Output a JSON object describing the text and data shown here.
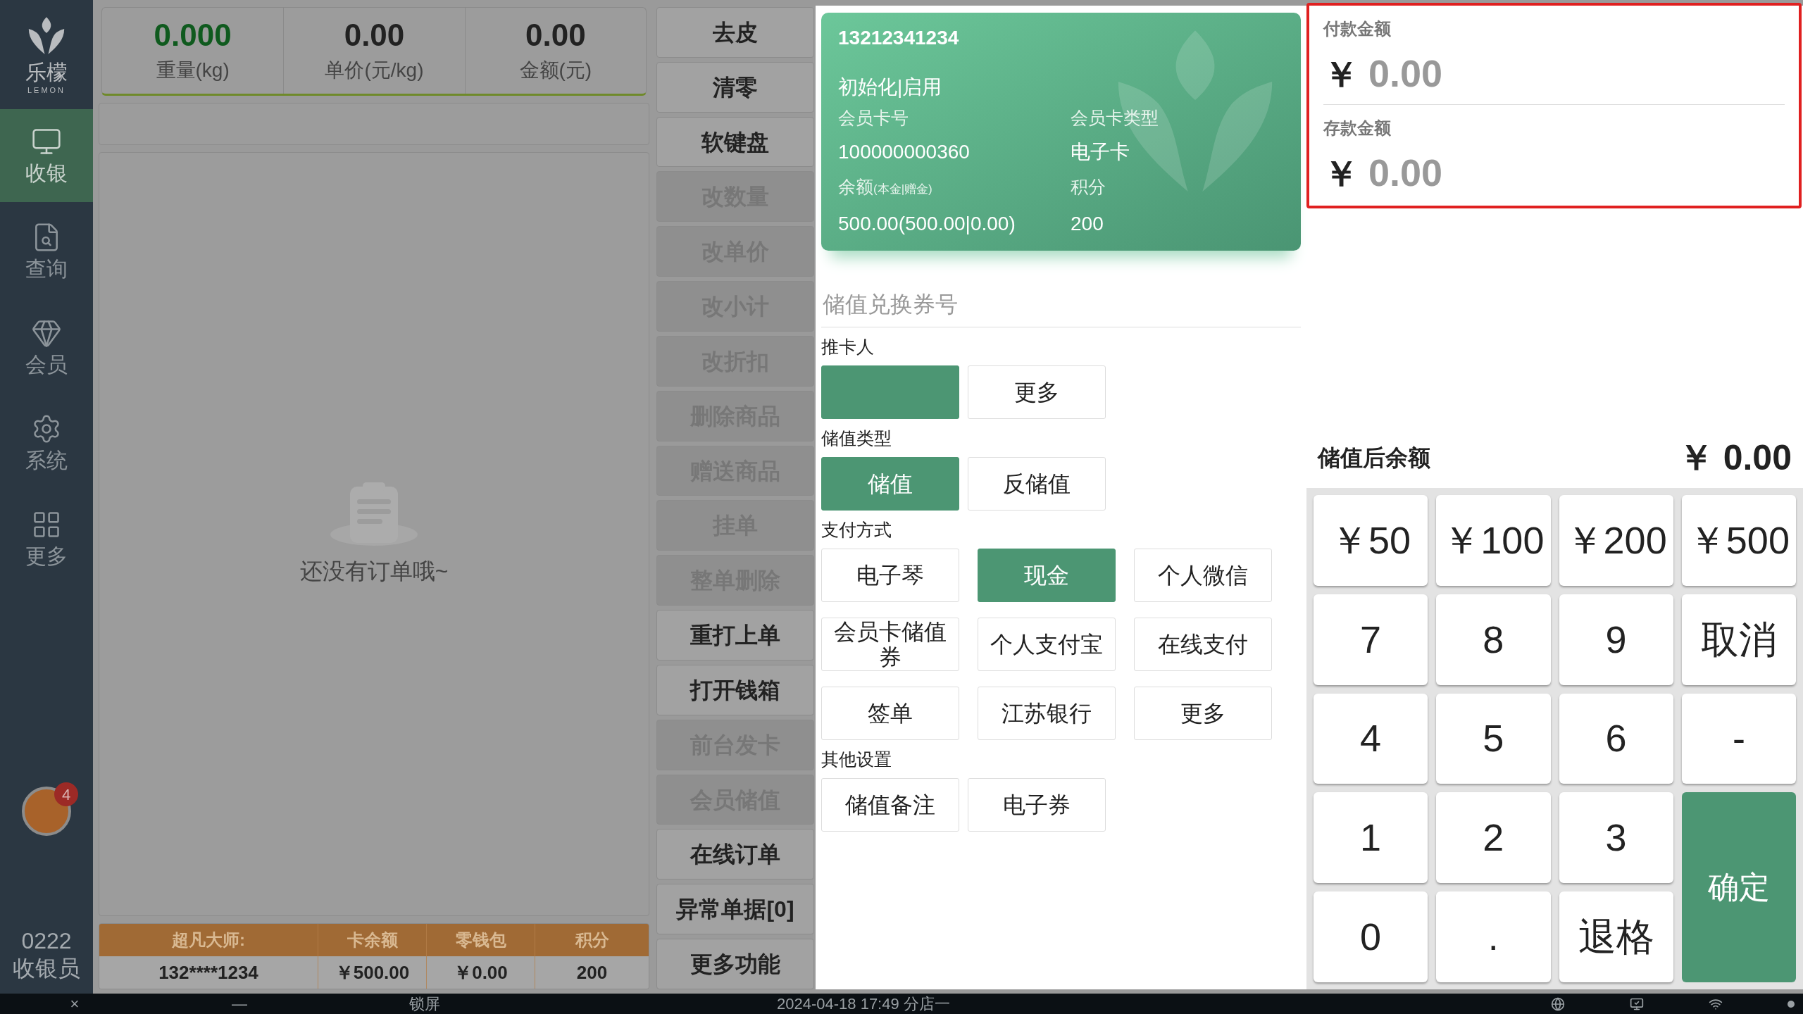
{
  "sidebar": {
    "logo_text": "乐檬",
    "logo_subtext": "LEMON",
    "items": [
      {
        "label": "收银",
        "selected": true,
        "kind": "cashier"
      },
      {
        "label": "查询",
        "selected": false,
        "kind": "query"
      },
      {
        "label": "会员",
        "selected": false,
        "kind": "member"
      },
      {
        "label": "系统",
        "selected": false,
        "kind": "system"
      },
      {
        "label": "更多",
        "selected": false,
        "kind": "more"
      }
    ],
    "notification_badge": "4",
    "user": {
      "id": "0222",
      "role": "收银员"
    }
  },
  "scale_readouts": [
    {
      "value": "0.000",
      "label": "重量(kg)",
      "highlighted": true
    },
    {
      "value": "0.00",
      "label": "单价(元/kg)",
      "highlighted": false
    },
    {
      "value": "0.00",
      "label": "金额(元)",
      "highlighted": false
    }
  ],
  "order_list": {
    "empty_message": "还没有订单哦~"
  },
  "member_table": {
    "columns": [
      "超凡大师:",
      "卡余额",
      "零钱包",
      "积分"
    ],
    "values": [
      "132****1234",
      "￥500.00",
      "￥0.00",
      "200"
    ]
  },
  "function_buttons": [
    {
      "label": "去皮",
      "disabled": false
    },
    {
      "label": "清零",
      "disabled": false
    },
    {
      "label": "软键盘",
      "disabled": false
    },
    {
      "label": "改数量",
      "disabled": true
    },
    {
      "label": "改单价",
      "disabled": true
    },
    {
      "label": "改小计",
      "disabled": true
    },
    {
      "label": "改折扣",
      "disabled": true
    },
    {
      "label": "删除商品",
      "disabled": true
    },
    {
      "label": "赠送商品",
      "disabled": true
    },
    {
      "label": "挂单",
      "disabled": true
    },
    {
      "label": "整单删除",
      "disabled": true
    },
    {
      "label": "重打上单",
      "disabled": false
    },
    {
      "label": "打开钱箱",
      "disabled": false
    },
    {
      "label": "前台发卡",
      "disabled": true
    },
    {
      "label": "会员储值",
      "disabled": true
    },
    {
      "label": "在线订单",
      "disabled": false
    },
    {
      "label": "异常单据[0]",
      "disabled": false
    },
    {
      "label": "更多功能",
      "disabled": false
    }
  ],
  "member_card": {
    "phone": "13212341234",
    "status": "初始化|启用",
    "fields": [
      {
        "label": "会员卡号",
        "value": "100000000360"
      },
      {
        "label": "会员卡类型",
        "value": "电子卡"
      },
      {
        "label": "余额",
        "note": "(本金|赠金)",
        "value": "500.00(500.00|0.00)"
      },
      {
        "label": "积分",
        "value": "200"
      }
    ]
  },
  "coupon_field": {
    "placeholder": "储值兑换券号"
  },
  "form_sections": [
    {
      "title": "推卡人",
      "options": [
        {
          "selected": true
        },
        {
          "label": "更多",
          "selected": false
        }
      ]
    },
    {
      "title": "储值类型",
      "options": [
        {
          "label": "储值",
          "selected": true
        },
        {
          "label": "反储值",
          "selected": false
        }
      ]
    },
    {
      "title": "支付方式",
      "options": [
        {
          "label": "电子琴",
          "selected": false
        },
        {
          "label": "现金",
          "selected": true
        },
        {
          "label": "个人微信",
          "selected": false
        },
        {
          "label": "会员卡储值券",
          "selected": false
        },
        {
          "label": "个人支付宝",
          "selected": false
        },
        {
          "label": "在线支付",
          "selected": false
        },
        {
          "label": "签单",
          "selected": false
        },
        {
          "label": "江苏银行",
          "selected": false
        },
        {
          "label": "更多",
          "selected": false
        }
      ]
    },
    {
      "title": "其他设置",
      "options": [
        {
          "label": "储值备注",
          "selected": false
        },
        {
          "label": "电子券",
          "selected": false
        }
      ]
    }
  ],
  "amounts": [
    {
      "label": "付款金额",
      "currency": "￥",
      "value": "0.00"
    },
    {
      "label": "存款金额",
      "currency": "￥",
      "value": "0.00"
    }
  ],
  "balance_after": {
    "label": "储值后余额",
    "value": "￥ 0.00"
  },
  "keypad": [
    {
      "label": "￥50",
      "kind": "key"
    },
    {
      "label": "￥100",
      "kind": "key"
    },
    {
      "label": "￥200",
      "kind": "key"
    },
    {
      "label": "￥500",
      "kind": "key"
    },
    {
      "label": "7",
      "kind": "key"
    },
    {
      "label": "8",
      "kind": "key"
    },
    {
      "label": "9",
      "kind": "key"
    },
    {
      "label": "取消",
      "kind": "key"
    },
    {
      "label": "4",
      "kind": "key"
    },
    {
      "label": "5",
      "kind": "key"
    },
    {
      "label": "6",
      "kind": "key"
    },
    {
      "label": "-",
      "kind": "key"
    },
    {
      "label": "1",
      "kind": "key"
    },
    {
      "label": "2",
      "kind": "key"
    },
    {
      "label": "3",
      "kind": "key"
    },
    {
      "label": "确定",
      "kind": "confirm"
    },
    {
      "label": "0",
      "kind": "key"
    },
    {
      "label": ".",
      "kind": "key"
    },
    {
      "label": "退格",
      "kind": "key"
    }
  ],
  "status_bar": {
    "close": "×",
    "minimize": "—",
    "lock": "锁屏",
    "datetime": "2024-04-18 17:49 分店一"
  }
}
